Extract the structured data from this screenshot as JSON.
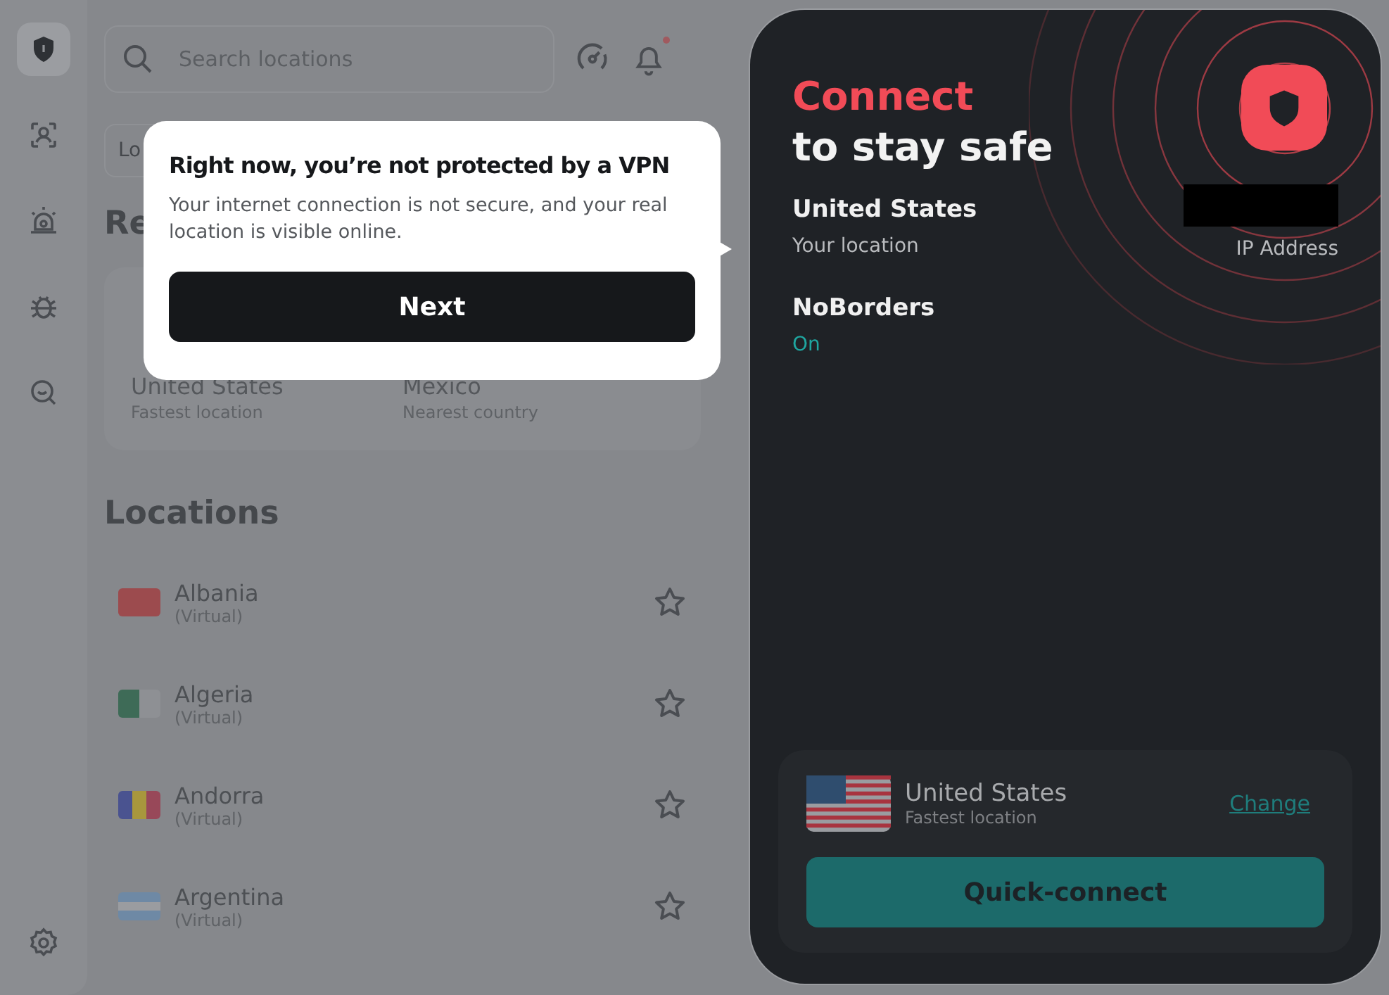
{
  "sidebar": {
    "items": [
      {
        "kind": "shield",
        "selected": true
      },
      {
        "kind": "person",
        "selected": false
      },
      {
        "kind": "alarm",
        "selected": false
      },
      {
        "kind": "bug",
        "selected": false
      },
      {
        "kind": "magnifier",
        "selected": false
      }
    ]
  },
  "search": {
    "placeholder": "Search locations"
  },
  "notifications": {
    "unread": true
  },
  "tab_partial": "Lo",
  "recommended": {
    "heading_partial": "Re",
    "items": [
      {
        "name": "United States",
        "detail": "Fastest location"
      },
      {
        "name": "Mexico",
        "detail": "Nearest country"
      }
    ]
  },
  "locations": {
    "heading": "Locations",
    "items": [
      {
        "name": "Albania",
        "detail": "(Virtual)",
        "favorite": false
      },
      {
        "name": "Algeria",
        "detail": "(Virtual)",
        "favorite": false
      },
      {
        "name": "Andorra",
        "detail": "(Virtual)",
        "favorite": false
      },
      {
        "name": "Argentina",
        "detail": "(Virtual)",
        "favorite": false
      }
    ]
  },
  "popup": {
    "title": "Right now, you’re not protected by a VPN",
    "body": "Your internet connection is not secure, and your real location is visible online.",
    "button": "Next"
  },
  "status_panel": {
    "title_accent": "Connect",
    "title": "to stay safe",
    "location": {
      "value": "United States",
      "label": "Your location"
    },
    "ip": {
      "label": "IP Address",
      "redacted": true
    },
    "noborders": {
      "name": "NoBorders",
      "status": "On"
    },
    "quick": {
      "name": "United States",
      "detail": "Fastest location",
      "change": "Change",
      "button": "Quick-connect"
    }
  }
}
